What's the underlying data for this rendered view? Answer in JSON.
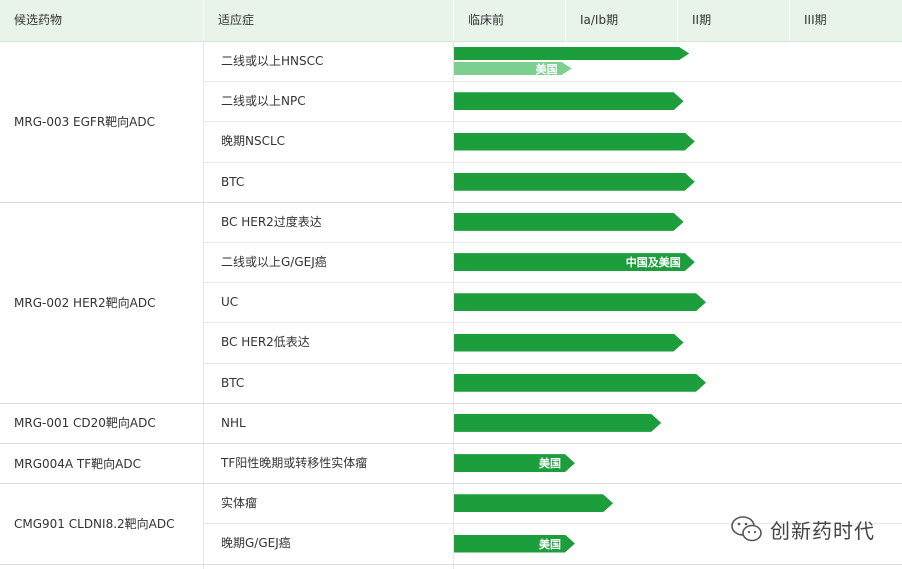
{
  "table": {
    "headers": [
      "候选药物",
      "适应症",
      "临床前",
      "Ia/Ib期",
      "II期",
      "III期"
    ]
  },
  "chart_data": {
    "type": "bar",
    "stages": [
      "临床前",
      "Ia/Ib期",
      "II期",
      "III期"
    ],
    "colors": {
      "primary": "#1d9e3c",
      "secondary": "#7dcf8f",
      "header_bg": "#e8f3ea"
    },
    "groups": [
      {
        "candidate": "MRG-003 EGFR靶向ADC",
        "rows": [
          {
            "indication": "二线或以上HNSCC",
            "bars": [
              {
                "progress": 2.1,
                "label": ""
              },
              {
                "progress": 1.05,
                "label": "美国",
                "variant": "light"
              }
            ]
          },
          {
            "indication": "二线或以上NPC",
            "bars": [
              {
                "progress": 2.05,
                "label": ""
              }
            ]
          },
          {
            "indication": "晚期NSCLC",
            "bars": [
              {
                "progress": 2.15,
                "label": ""
              }
            ]
          },
          {
            "indication": "BTC",
            "bars": [
              {
                "progress": 2.15,
                "label": ""
              }
            ]
          }
        ]
      },
      {
        "candidate": "MRG-002 HER2靶向ADC",
        "rows": [
          {
            "indication": "BC HER2过度表达",
            "bars": [
              {
                "progress": 2.05,
                "label": ""
              }
            ]
          },
          {
            "indication": "二线或以上G/GEJ癌",
            "bars": [
              {
                "progress": 2.15,
                "label": "中国及美国"
              }
            ]
          },
          {
            "indication": "UC",
            "bars": [
              {
                "progress": 2.25,
                "label": ""
              }
            ]
          },
          {
            "indication": "BC HER2低表达",
            "bars": [
              {
                "progress": 2.05,
                "label": ""
              }
            ]
          },
          {
            "indication": "BTC",
            "bars": [
              {
                "progress": 2.25,
                "label": ""
              }
            ]
          }
        ]
      },
      {
        "candidate": "MRG-001 CD20靶向ADC",
        "rows": [
          {
            "indication": "NHL",
            "bars": [
              {
                "progress": 1.85,
                "label": ""
              }
            ]
          }
        ]
      },
      {
        "candidate": "MRG004A TF靶向ADC",
        "rows": [
          {
            "indication": "TF阳性晚期或转移性实体瘤",
            "bars": [
              {
                "progress": 1.08,
                "label": "美国"
              }
            ]
          }
        ]
      },
      {
        "candidate": "CMG901 CLDNI8.2靶向ADC",
        "rows": [
          {
            "indication": "实体瘤",
            "bars": [
              {
                "progress": 1.42,
                "label": ""
              }
            ]
          },
          {
            "indication": "晚期G/GEJ癌",
            "bars": [
              {
                "progress": 1.08,
                "label": "美国"
              }
            ]
          }
        ]
      }
    ]
  },
  "watermark": {
    "text": "创新药时代",
    "icon": "wechat-icon"
  }
}
